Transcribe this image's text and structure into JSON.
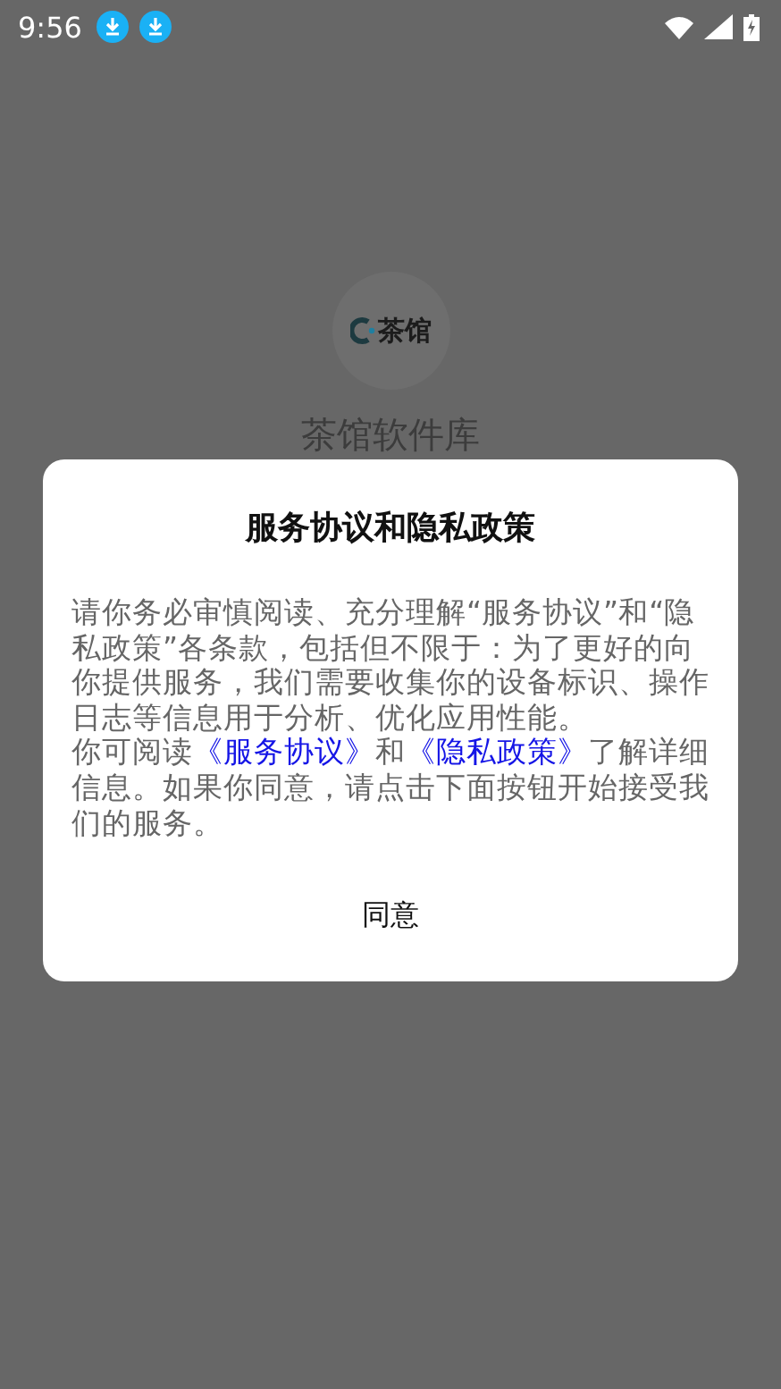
{
  "status_bar": {
    "time": "9:56",
    "notifications": [
      {
        "kind": "download"
      },
      {
        "kind": "download"
      }
    ]
  },
  "app": {
    "logo_text": "茶馆",
    "name": "茶馆软件库"
  },
  "dialog": {
    "title": "服务协议和隐私政策",
    "paragraphs": [
      {
        "text": "请你务必审慎阅读、充分理解“服务协议”和“隐私政策”各条款，包括但不限于：为了更好的向你提供服务，我们需要收集你的设备标识、操作日志等信息用于分析、优化应用性能。"
      },
      {
        "before": "你可阅读",
        "link1": "《服务协议》",
        "middle": "和",
        "link2": "《隐私政策》",
        "after": "了解详细信息。如果你同意，请点击下面按钮开始接受我们的服务。"
      }
    ],
    "button": "同意"
  }
}
